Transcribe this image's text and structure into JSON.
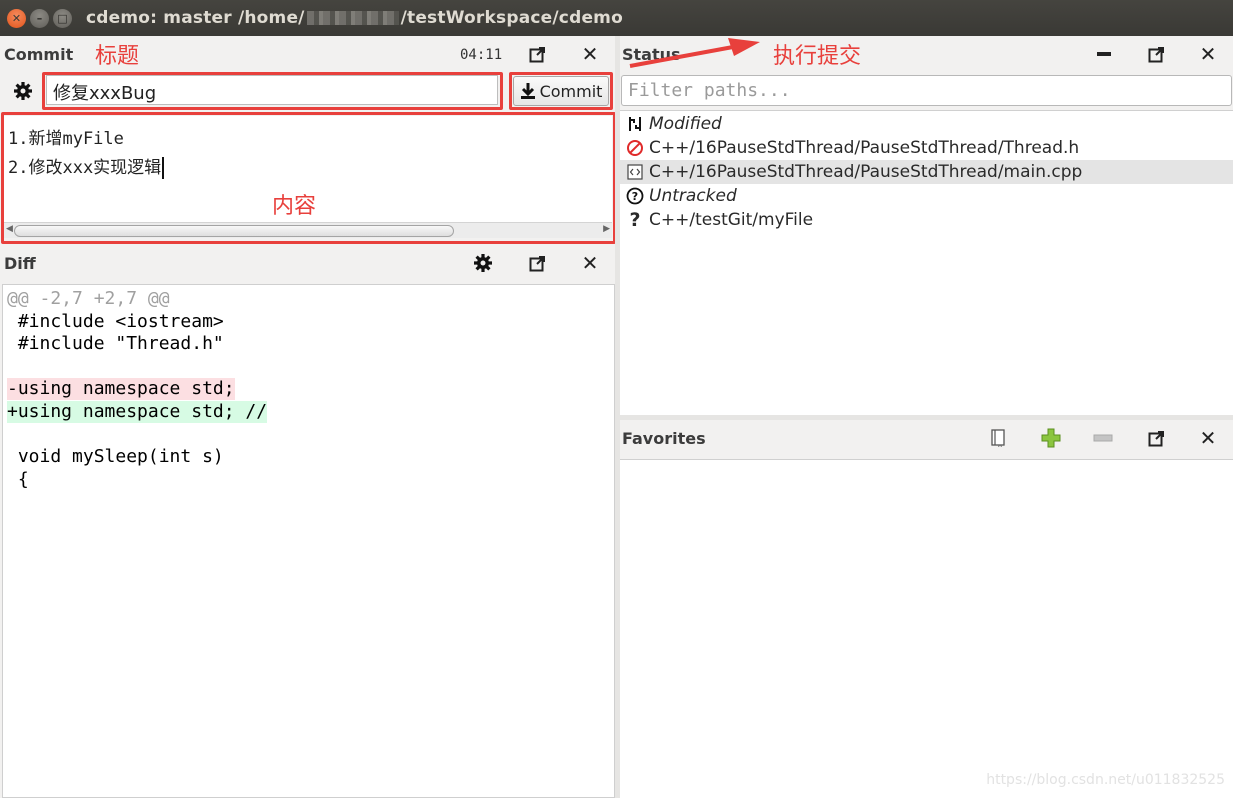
{
  "window": {
    "title_prefix": "cdemo: master /home/",
    "title_suffix": "/testWorkspace/cdemo"
  },
  "commit": {
    "panel_title": "Commit",
    "time": "04:11",
    "title_value": "修复xxxBug",
    "button_label": "Commit",
    "message_lines": [
      "1.新增myFile",
      "2.修改xxx实现逻辑"
    ],
    "annotations": {
      "title": "标题",
      "content": "内容",
      "execute": "执行提交"
    }
  },
  "diff": {
    "panel_title": "Diff",
    "lines": [
      {
        "text": "@@ -2,7 +2,7 @@",
        "kind": "hunk"
      },
      {
        "text": " #include <iostream>",
        "kind": "ctx"
      },
      {
        "text": " #include \"Thread.h\"",
        "kind": "ctx"
      },
      {
        "text": "",
        "kind": "ctx"
      },
      {
        "text": "-using namespace std;",
        "kind": "del"
      },
      {
        "text": "+using namespace std; //",
        "kind": "add"
      },
      {
        "text": "",
        "kind": "ctx"
      },
      {
        "text": " void mySleep(int s)",
        "kind": "ctx"
      },
      {
        "text": " {",
        "kind": "ctx"
      }
    ]
  },
  "status": {
    "panel_title": "Status",
    "filter_placeholder": "Filter paths...",
    "rows": [
      {
        "label": "Modified",
        "icon": "modified-icon",
        "group": true
      },
      {
        "label": "C++/16PauseStdThread/PauseStdThread/Thread.h",
        "icon": "deleted-icon"
      },
      {
        "label": "C++/16PauseStdThread/PauseStdThread/main.cpp",
        "icon": "source-file-icon",
        "selected": true
      },
      {
        "label": "Untracked",
        "icon": "untracked-icon",
        "group": true
      },
      {
        "label": "C++/testGit/myFile",
        "icon": "question-icon"
      }
    ]
  },
  "favorites": {
    "panel_title": "Favorites"
  },
  "watermark": "https://blog.csdn.net/u011832525",
  "colors": {
    "annotation": "#e8403c",
    "diff_del_bg": "#fcdfe2",
    "diff_add_bg": "#d7fbe4"
  }
}
